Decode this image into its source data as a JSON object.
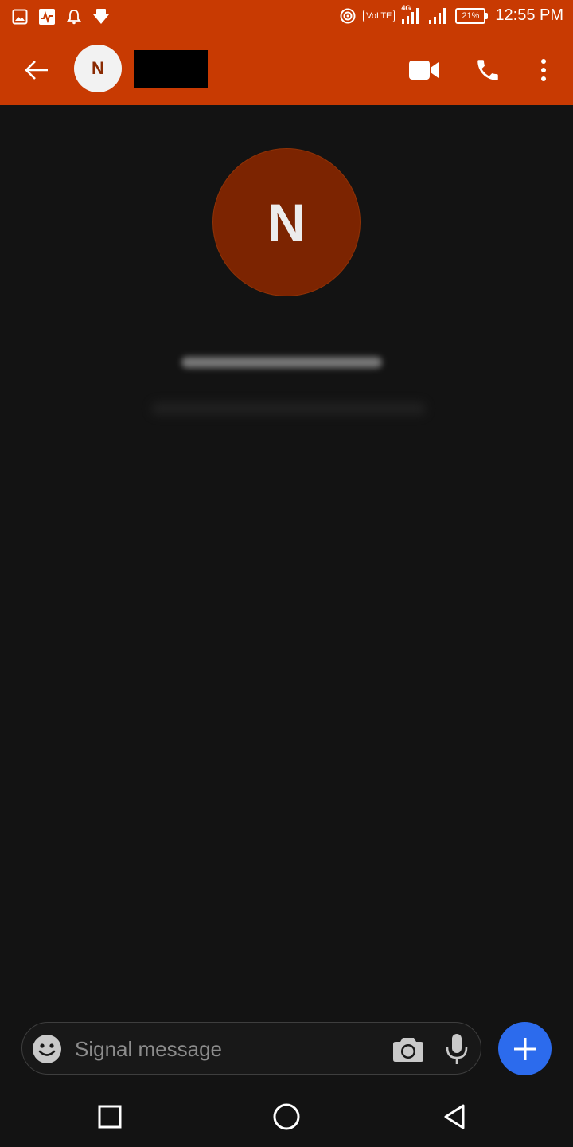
{
  "status_bar": {
    "time": "12:55 PM",
    "battery": "21%",
    "network_badge": "VoLTE",
    "network_type": "4G",
    "left_icons": [
      "gallery-icon",
      "activity-icon",
      "bell-icon",
      "download-icon"
    ],
    "right_icons": [
      "hotspot-icon",
      "volte-icon",
      "signal-4g-icon",
      "signal-icon",
      "battery-icon"
    ]
  },
  "toolbar": {
    "avatar_initial": "N",
    "contact_name": "",
    "icons": [
      "back-arrow-icon",
      "video-call-icon",
      "phone-call-icon",
      "more-vert-icon"
    ]
  },
  "conversation": {
    "avatar_initial": "N"
  },
  "compose": {
    "placeholder": "Signal message",
    "icons": [
      "emoji-icon",
      "camera-icon",
      "mic-icon",
      "plus-icon"
    ]
  },
  "colors": {
    "toolbar": "#c83a02",
    "avatar_large": "#7c2401",
    "background": "#131313",
    "accent_blue": "#2c6bed"
  }
}
